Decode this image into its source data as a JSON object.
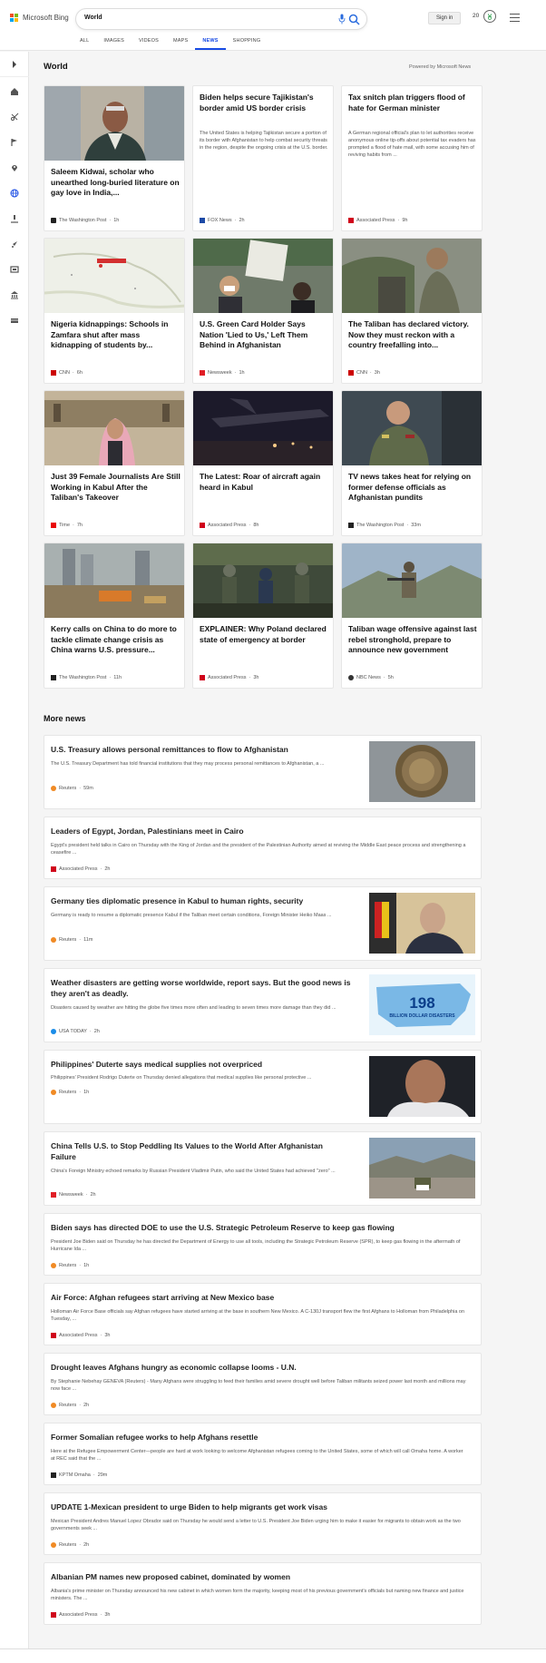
{
  "header": {
    "logo_text": "Microsoft Bing",
    "search_value": "World",
    "sign_in": "Sign in",
    "points": "20"
  },
  "tabs": [
    "ALL",
    "IMAGES",
    "VIDEOS",
    "MAPS",
    "NEWS",
    "SHOPPING"
  ],
  "active_tab": "NEWS",
  "sidebar_icons": [
    "chevron-right-icon",
    "home-icon",
    "scissors-icon",
    "flag-icon",
    "location-icon",
    "globe-icon",
    "microscope-icon",
    "rocket-icon",
    "film-icon",
    "bank-icon",
    "money-icon"
  ],
  "section_title": "World",
  "powered_by": "Powered by Microsoft News",
  "cards": [
    {
      "headline": "Saleem Kidwai, scholar who unearthed long-buried literature on gay love in India,...",
      "source": "The Washington Post",
      "time": "1h"
    },
    {
      "headline": "Biden helps secure Tajikistan's border amid US border crisis",
      "desc": "The United States is helping Tajikistan secure a portion of its border with Afghanistan to help combat security threats in the region, despite the ongoing crisis at the U.S. border.",
      "source": "FOX News",
      "time": "2h"
    },
    {
      "headline": "Tax snitch plan triggers flood of hate for German minister",
      "desc": "A German regional official's plan to let authorities receive anonymous online tip-offs about potential tax evaders has prompted a flood of hate mail, with some accusing him of reviving habits from ...",
      "source": "Associated Press",
      "time": "9h"
    },
    {
      "headline": "Nigeria kidnappings: Schools in Zamfara shut after mass kidnapping of students by...",
      "source": "CNN",
      "time": "6h"
    },
    {
      "headline": "U.S. Green Card Holder Says Nation 'Lied to Us,' Left Them Behind in Afghanistan",
      "source": "Newsweek",
      "time": "1h"
    },
    {
      "headline": "The Taliban has declared victory. Now they must reckon with a country freefalling into...",
      "source": "CNN",
      "time": "3h"
    },
    {
      "headline": "Just 39 Female Journalists Are Still Working in Kabul After the Taliban's Takeover",
      "source": "Time",
      "time": "7h"
    },
    {
      "headline": "The Latest: Roar of aircraft again heard in Kabul",
      "source": "Associated Press",
      "time": "8h"
    },
    {
      "headline": "TV news takes heat for relying on former defense officials as Afghanistan pundits",
      "source": "The Washington Post",
      "time": "33m"
    },
    {
      "headline": "Kerry calls on China to do more to tackle climate change crisis as China warns U.S. pressure...",
      "source": "The Washington Post",
      "time": "11h"
    },
    {
      "headline": "EXPLAINER: Why Poland declared state of emergency at border",
      "source": "Associated Press",
      "time": "3h"
    },
    {
      "headline": "Taliban wage offensive against last rebel stronghold, prepare to announce new government",
      "source": "NBC News",
      "time": "5h"
    }
  ],
  "more_news_title": "More news",
  "more_news": [
    {
      "headline": "U.S. Treasury allows personal remittances to flow to Afghanistan",
      "desc": "The U.S. Treasury Department has told financial institutions that they may process personal remittances to Afghanistan, a ...",
      "source": "Reuters",
      "time": "59m"
    },
    {
      "headline": "Leaders of Egypt, Jordan, Palestinians meet in Cairo",
      "desc": "Egypt's president held talks in Cairo on Thursday with the King of Jordan and the president of the Palestinian Authority aimed at reviving the Middle East peace process and strengthening a ceasefire ...",
      "source": "Associated Press",
      "time": "2h"
    },
    {
      "headline": "Germany ties diplomatic presence in Kabul to human rights, security",
      "desc": "Germany is ready to resume a diplomatic presence Kabul if the Taliban meet certain conditions, Foreign Minister Heiko Maas ...",
      "source": "Reuters",
      "time": "11m"
    },
    {
      "headline": "Weather disasters are getting worse worldwide, report says. But the good news is they aren't as deadly.",
      "desc": "Disasters caused by weather are hitting the globe five times more often and leading to seven times more damage than they did ...",
      "source": "USA TODAY",
      "time": "2h",
      "image_number": "198",
      "image_caption": "BILLION DOLLAR DISASTERS"
    },
    {
      "headline": "Philippines' Duterte says medical supplies not overpriced",
      "desc": "Philippines' President Rodrigo Duterte on Thursday denied allegations that medical supplies like personal protective ...",
      "source": "Reuters",
      "time": "1h"
    },
    {
      "headline": "China Tells U.S. to Stop Peddling Its Values to the World After Afghanistan Failure",
      "desc": "China's Foreign Ministry echoed remarks by Russian President Vladimir Putin, who said the United States had achieved \"zero\" ...",
      "source": "Newsweek",
      "time": "2h"
    },
    {
      "headline": "Biden says has directed DOE to use the U.S. Strategic Petroleum Reserve to keep gas flowing",
      "desc": "President Joe Biden said on Thursday he has directed the Department of Energy to use all tools, including the Strategic Petroleum Reserve (SPR), to keep gas flowing in the aftermath of Hurricane Ida ...",
      "source": "Reuters",
      "time": "1h"
    },
    {
      "headline": "Air Force: Afghan refugees start arriving at New Mexico base",
      "desc": "Holloman Air Force Base officials say Afghan refugees have started arriving at the base in southern New Mexico. A C-130J transport flew the first Afghans to Holloman from Philadelphia on Tuesday, ...",
      "source": "Associated Press",
      "time": "3h"
    },
    {
      "headline": "Drought leaves Afghans hungry as economic collapse looms - U.N.",
      "desc": "By Stephanie Nebehay GENEVA (Reuters) - Many Afghans were struggling to feed their families amid severe drought well before Taliban militants seized power last month and millions may now face ...",
      "source": "Reuters",
      "time": "2h"
    },
    {
      "headline": "Former Somalian refugee works to help Afghans resettle",
      "desc": "Here at the Refugee Empowerment Center—people are hard at work looking to welcome Afghanistan refugees coming to the United States, some of which will call Omaha home. A worker at REC said that the ...",
      "source": "KPTM Omaha",
      "time": "29m"
    },
    {
      "headline": "UPDATE 1-Mexican president to urge Biden to help migrants get work visas",
      "desc": "Mexican President Andres Manuel Lopez Obrador said on Thursday he would send a letter to U.S. President Joe Biden urging him to make it easier for migrants to obtain work as the two governments seek ...",
      "source": "Reuters",
      "time": "2h"
    },
    {
      "headline": "Albanian PM names new proposed cabinet, dominated by women",
      "desc": "Albania's prime minister on Thursday announced his new cabinet in which women form the majority, keeping most of his previous government's officials but naming new finance and justice ministers. The ...",
      "source": "Associated Press",
      "time": "3h"
    }
  ],
  "colors": {
    "accent": "#174ae4",
    "reuters": "#f08a24",
    "ap": "#d0021b",
    "cnn": "#cc0000"
  }
}
